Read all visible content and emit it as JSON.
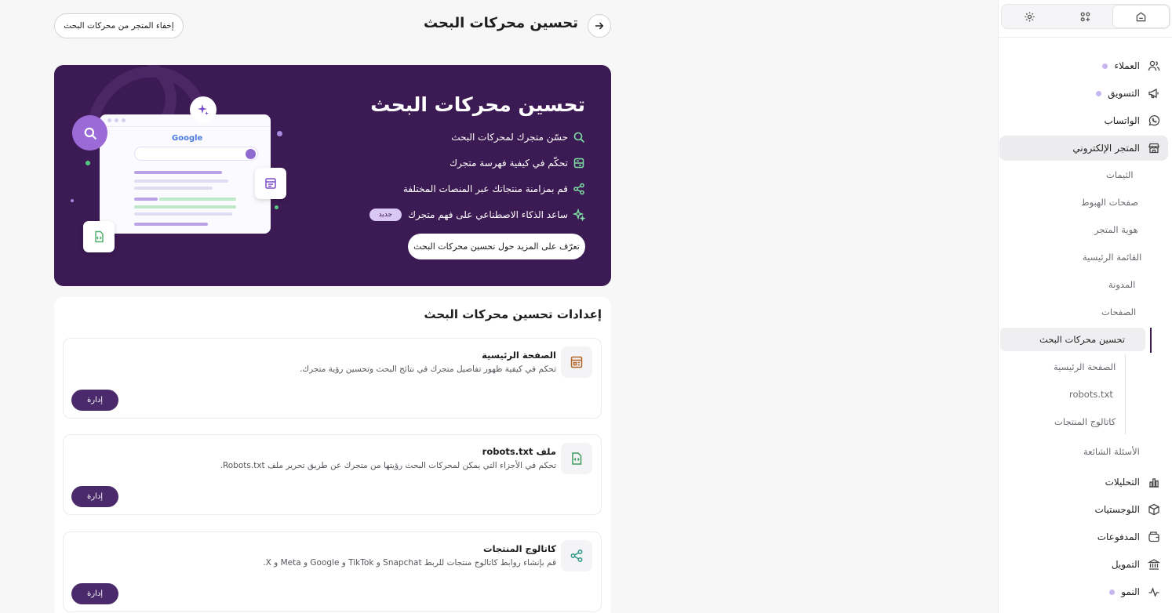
{
  "header": {
    "title": "تحسين محركات البحث",
    "hide_button": "إخفاء المتجر من محركات البحث"
  },
  "banner": {
    "title": "تحسين محركات البحث",
    "features": [
      {
        "text": "حسّن متجرك لمحركات البحث",
        "icon": "search-icon"
      },
      {
        "text": "تحكّم في كيفية فهرسة متجرك",
        "icon": "database-icon"
      },
      {
        "text": "قم بمزامنة منتجاتك عبر المنصات المختلفة",
        "icon": "share-icon"
      },
      {
        "text": "ساعد الذكاء الاصطناعي على فهم متجرك",
        "icon": "sparkle-icon",
        "badge": "جديد"
      }
    ],
    "learn_more": "تعرّف على المزيد حول تحسين محركات البحث",
    "illustration": {
      "logo_text": "Google"
    },
    "colors": {
      "background": "#3c1a53",
      "feature_icon": "#7ee0a5"
    }
  },
  "settings": {
    "title": "إعدادات تحسين محركات البحث",
    "cards": [
      {
        "title": "الصفحة الرئيسية",
        "desc": "تحكم في كيفية ظهور تفاصيل متجرك في نتائج البحث وتحسين رؤية متجرك.",
        "button": "إدارة",
        "icon": "page-layout-icon"
      },
      {
        "title": "ملف robots.txt",
        "desc": "تحكم في الأجزاء التي يمكن لمحركات البحث رؤيتها من متجرك عن طريق تحرير ملف Robots.txt.",
        "button": "إدارة",
        "icon": "code-file-icon"
      },
      {
        "title": "كاتالوج المنتجات",
        "desc": "قم بإنشاء روابط كاتالوج منتجات للربط Snapchat و TikTok و Google و Meta و X.",
        "button": "إدارة",
        "icon": "share-icon"
      }
    ]
  },
  "sidebar": {
    "tabs": [
      {
        "name": "home",
        "icon": "store-home-icon",
        "active": true
      },
      {
        "name": "apps",
        "icon": "apps-icon",
        "active": false
      },
      {
        "name": "settings",
        "icon": "gear-icon",
        "active": false
      }
    ],
    "items": [
      {
        "label": "العملاء",
        "icon": "users-icon",
        "dot": true
      },
      {
        "label": "التسويق",
        "icon": "megaphone-icon",
        "dot": true
      },
      {
        "label": "الواتساب",
        "icon": "whatsapp-icon",
        "dot": false
      },
      {
        "label": "المتجر الإلكتروني",
        "icon": "store-icon",
        "dot": false,
        "active": true
      }
    ],
    "store_sub": [
      "الثيمات",
      "صفحات الهبوط",
      "هوية المتجر",
      "القائمة الرئيسية",
      "المدونة",
      "الصفحات",
      "تحسين محركات البحث"
    ],
    "seo_sub": [
      "الصفحة الرئيسية",
      "robots.txt",
      "كاتالوج المنتجات"
    ],
    "faq": "الأسئلة الشائعة",
    "items_after": [
      {
        "label": "التحليلات",
        "icon": "chart-icon",
        "dot": false
      },
      {
        "label": "اللوجستيات",
        "icon": "box-icon",
        "dot": false
      },
      {
        "label": "المدفوعات",
        "icon": "payments-icon",
        "dot": false
      },
      {
        "label": "التمويل",
        "icon": "bank-icon",
        "dot": false
      },
      {
        "label": "النمو",
        "icon": "pulse-icon",
        "dot": true
      }
    ],
    "accent": "#3b1d52",
    "dot_color": "#c8b6f0"
  }
}
